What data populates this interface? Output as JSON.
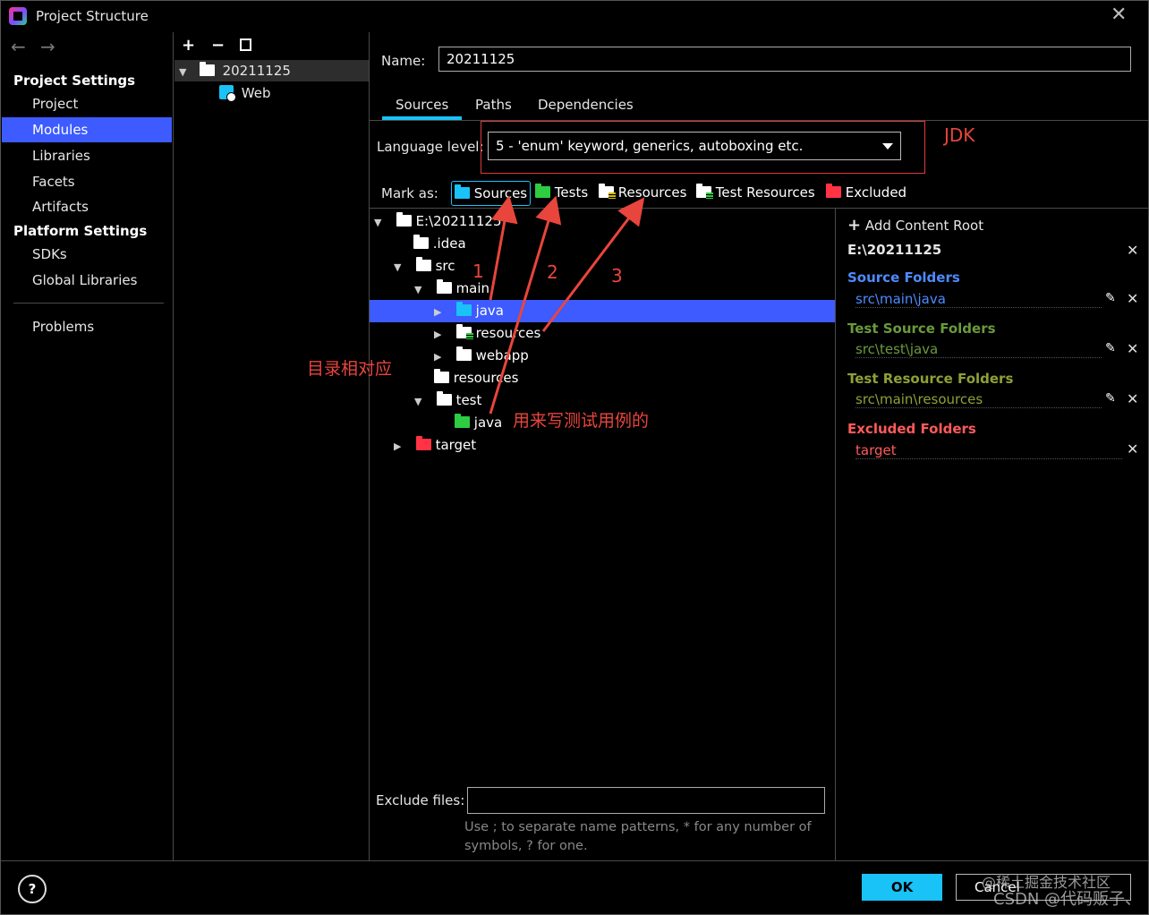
{
  "window": {
    "title": "Project Structure"
  },
  "sidebar": {
    "project_settings_header": "Project Settings",
    "project_items": [
      "Project",
      "Modules",
      "Libraries",
      "Facets",
      "Artifacts"
    ],
    "platform_settings_header": "Platform Settings",
    "platform_items": [
      "SDKs",
      "Global Libraries"
    ],
    "problems": "Problems"
  },
  "modules": {
    "root": "20211125",
    "child": "Web"
  },
  "details": {
    "name_label": "Name:",
    "name_value": "20211125",
    "tabs": [
      "Sources",
      "Paths",
      "Dependencies"
    ],
    "language_level_label": "Language level:",
    "language_level_value": "5 - 'enum' keyword, generics, autoboxing etc.",
    "mark_as_label": "Mark as:",
    "mark_buttons": [
      "Sources",
      "Tests",
      "Resources",
      "Test Resources",
      "Excluded"
    ]
  },
  "tree": {
    "root": "E:\\20211125",
    "idea": ".idea",
    "src": "src",
    "main": "main",
    "java": "java",
    "resources_main": "resources",
    "webapp": "webapp",
    "resources": "resources",
    "test": "test",
    "test_java": "java",
    "target": "target"
  },
  "content_root": {
    "add_label": "Add Content Root",
    "root_path": "E:\\20211125",
    "source_header": "Source Folders",
    "source_path": "src\\main\\java",
    "test_source_header": "Test Source Folders",
    "test_source_path": "src\\test\\java",
    "test_resource_header": "Test Resource Folders",
    "test_resource_path": "src\\main\\resources",
    "excluded_header": "Excluded Folders",
    "excluded_path": "target"
  },
  "exclude": {
    "label": "Exclude files:",
    "hint_line1": "Use ; to separate name patterns, * for any number of",
    "hint_line2": "symbols, ? for one."
  },
  "buttons": {
    "help": "?",
    "ok": "OK",
    "cancel": "Cancel"
  },
  "annotations": {
    "jdk": "JDK",
    "n1": "1",
    "n2": "2",
    "n3": "3",
    "dir_match": "目录相对应",
    "test_cases": "用来写测试用例的"
  },
  "watermark": {
    "line1": "@稀土掘金技术社区",
    "line2": "CSDN @代码贩子、"
  },
  "colors": {
    "selection": "#3d5bff",
    "accent": "#19c2f7",
    "annotation": "#e8453c"
  }
}
